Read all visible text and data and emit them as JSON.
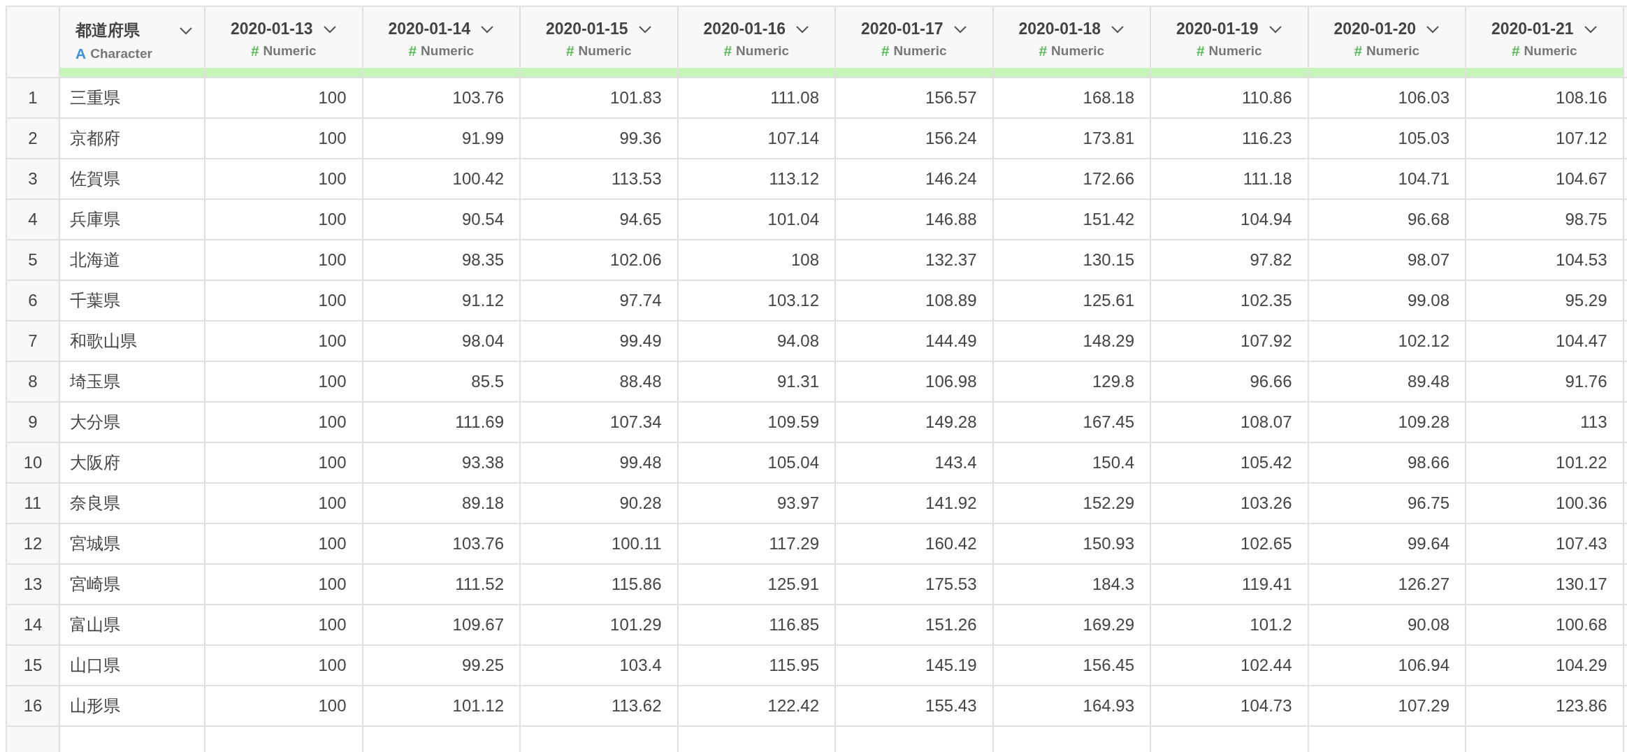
{
  "table": {
    "columns": [
      {
        "title": "都道府県",
        "type": {
          "kind": "character",
          "icon": "A",
          "label": "Character"
        }
      },
      {
        "title": "2020-01-13",
        "type": {
          "kind": "numeric",
          "icon": "#",
          "label": "Numeric"
        }
      },
      {
        "title": "2020-01-14",
        "type": {
          "kind": "numeric",
          "icon": "#",
          "label": "Numeric"
        }
      },
      {
        "title": "2020-01-15",
        "type": {
          "kind": "numeric",
          "icon": "#",
          "label": "Numeric"
        }
      },
      {
        "title": "2020-01-16",
        "type": {
          "kind": "numeric",
          "icon": "#",
          "label": "Numeric"
        }
      },
      {
        "title": "2020-01-17",
        "type": {
          "kind": "numeric",
          "icon": "#",
          "label": "Numeric"
        }
      },
      {
        "title": "2020-01-18",
        "type": {
          "kind": "numeric",
          "icon": "#",
          "label": "Numeric"
        }
      },
      {
        "title": "2020-01-19",
        "type": {
          "kind": "numeric",
          "icon": "#",
          "label": "Numeric"
        }
      },
      {
        "title": "2020-01-20",
        "type": {
          "kind": "numeric",
          "icon": "#",
          "label": "Numeric"
        }
      },
      {
        "title": "2020-01-21",
        "type": {
          "kind": "numeric",
          "icon": "#",
          "label": "Numeric"
        }
      }
    ],
    "rows": [
      {
        "number": "1",
        "cells": [
          "三重県",
          "100",
          "103.76",
          "101.83",
          "111.08",
          "156.57",
          "168.18",
          "110.86",
          "106.03",
          "108.16"
        ]
      },
      {
        "number": "2",
        "cells": [
          "京都府",
          "100",
          "91.99",
          "99.36",
          "107.14",
          "156.24",
          "173.81",
          "116.23",
          "105.03",
          "107.12"
        ]
      },
      {
        "number": "3",
        "cells": [
          "佐賀県",
          "100",
          "100.42",
          "113.53",
          "113.12",
          "146.24",
          "172.66",
          "111.18",
          "104.71",
          "104.67"
        ]
      },
      {
        "number": "4",
        "cells": [
          "兵庫県",
          "100",
          "90.54",
          "94.65",
          "101.04",
          "146.88",
          "151.42",
          "104.94",
          "96.68",
          "98.75"
        ]
      },
      {
        "number": "5",
        "cells": [
          "北海道",
          "100",
          "98.35",
          "102.06",
          "108",
          "132.37",
          "130.15",
          "97.82",
          "98.07",
          "104.53"
        ]
      },
      {
        "number": "6",
        "cells": [
          "千葉県",
          "100",
          "91.12",
          "97.74",
          "103.12",
          "108.89",
          "125.61",
          "102.35",
          "99.08",
          "95.29"
        ]
      },
      {
        "number": "7",
        "cells": [
          "和歌山県",
          "100",
          "98.04",
          "99.49",
          "94.08",
          "144.49",
          "148.29",
          "107.92",
          "102.12",
          "104.47"
        ]
      },
      {
        "number": "8",
        "cells": [
          "埼玉県",
          "100",
          "85.5",
          "88.48",
          "91.31",
          "106.98",
          "129.8",
          "96.66",
          "89.48",
          "91.76"
        ]
      },
      {
        "number": "9",
        "cells": [
          "大分県",
          "100",
          "111.69",
          "107.34",
          "109.59",
          "149.28",
          "167.45",
          "108.07",
          "109.28",
          "113"
        ]
      },
      {
        "number": "10",
        "cells": [
          "大阪府",
          "100",
          "93.38",
          "99.48",
          "105.04",
          "143.4",
          "150.4",
          "105.42",
          "98.66",
          "101.22"
        ]
      },
      {
        "number": "11",
        "cells": [
          "奈良県",
          "100",
          "89.18",
          "90.28",
          "93.97",
          "141.92",
          "152.29",
          "103.26",
          "96.75",
          "100.36"
        ]
      },
      {
        "number": "12",
        "cells": [
          "宮城県",
          "100",
          "103.76",
          "100.11",
          "117.29",
          "160.42",
          "150.93",
          "102.65",
          "99.64",
          "107.43"
        ]
      },
      {
        "number": "13",
        "cells": [
          "宮崎県",
          "100",
          "111.52",
          "115.86",
          "125.91",
          "175.53",
          "184.3",
          "119.41",
          "126.27",
          "130.17"
        ]
      },
      {
        "number": "14",
        "cells": [
          "富山県",
          "100",
          "109.67",
          "101.29",
          "116.85",
          "151.26",
          "169.29",
          "101.2",
          "90.08",
          "100.68"
        ]
      },
      {
        "number": "15",
        "cells": [
          "山口県",
          "100",
          "99.25",
          "103.4",
          "115.95",
          "145.19",
          "156.45",
          "102.44",
          "106.94",
          "104.29"
        ]
      },
      {
        "number": "16",
        "cells": [
          "山形県",
          "100",
          "101.12",
          "113.62",
          "122.42",
          "155.43",
          "164.93",
          "104.73",
          "107.29",
          "123.86"
        ]
      }
    ]
  }
}
